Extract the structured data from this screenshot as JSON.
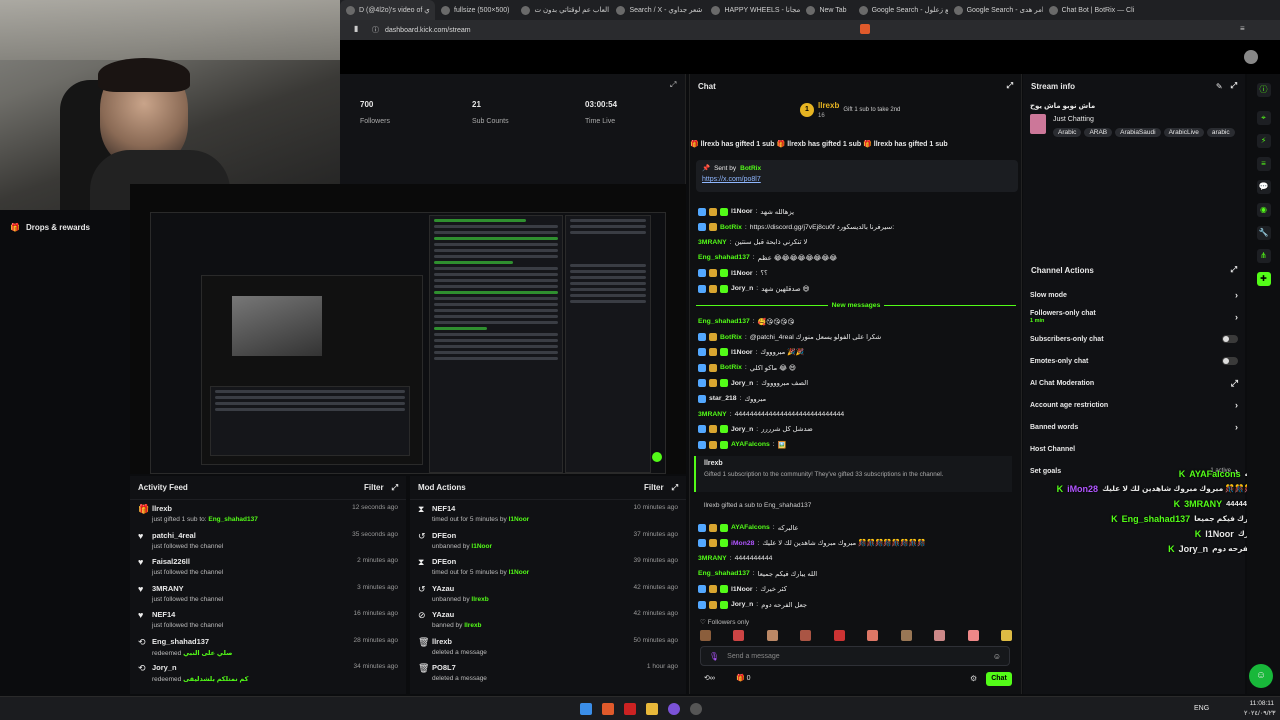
{
  "browser": {
    "tabs": [
      "D (@4l2o)'s video of ي",
      "fullsize (500×500)",
      "العاب عم لوقتاتي بدون ت",
      "Search / X - شعر جداوي",
      "HAPPY WHEELS - مجانا",
      "New Tab",
      "Google Search - بلع زعلول",
      "Google Search - امر هدى",
      "Chat Bot | BotRix — Cli"
    ],
    "url": "dashboard.kick.com/stream"
  },
  "overlay": {
    "drops": "Drops & rewards"
  },
  "stats": [
    {
      "value": "700",
      "label": "Followers"
    },
    {
      "value": "21",
      "label": "Sub Counts"
    },
    {
      "value": "03:00:54",
      "label": "Time Live"
    }
  ],
  "activity": {
    "title": "Activity Feed",
    "filter": "Filter",
    "items": [
      {
        "icon": "gift",
        "name": "llrexb",
        "desc": "just gifted 1 sub to:",
        "target": "Eng_shahad137",
        "time": "12 seconds ago"
      },
      {
        "icon": "heart",
        "name": "patchi_4real",
        "desc": "just followed the channel",
        "target": "",
        "time": "35 seconds ago"
      },
      {
        "icon": "heart",
        "name": "Faisal226ll",
        "desc": "just followed the channel",
        "target": "",
        "time": "2 minutes ago"
      },
      {
        "icon": "heart",
        "name": "3MRANY",
        "desc": "just followed the channel",
        "target": "",
        "time": "3 minutes ago"
      },
      {
        "icon": "heart",
        "name": "NEF14",
        "desc": "just followed the channel",
        "target": "",
        "time": "16 minutes ago"
      },
      {
        "icon": "redeem",
        "name": "Eng_shahad137",
        "desc": "redeemed",
        "target": "صلي على النبي",
        "time": "28 minutes ago"
      },
      {
        "icon": "redeem",
        "name": "Jory_n",
        "desc": "redeemed",
        "target": "كم نمتلكم بلشدليقى",
        "time": "34 minutes ago"
      }
    ]
  },
  "mod": {
    "title": "Mod Actions",
    "filter": "Filter",
    "items": [
      {
        "icon": "timeout",
        "name": "NEF14",
        "desc": "timed out for 5 minutes by",
        "by": "l1Noor",
        "time": "10 minutes ago"
      },
      {
        "icon": "unban",
        "name": "DFEon",
        "desc": "unbanned by",
        "by": "l1Noor",
        "time": "37 minutes ago"
      },
      {
        "icon": "timeout",
        "name": "DFEon",
        "desc": "timed out for 5 minutes by",
        "by": "l1Noor",
        "time": "39 minutes ago"
      },
      {
        "icon": "unban",
        "name": "YAzau",
        "desc": "unbanned by",
        "by": "llrexb",
        "time": "42 minutes ago"
      },
      {
        "icon": "ban",
        "name": "YAzau",
        "desc": "banned by",
        "by": "llrexb",
        "time": "42 minutes ago"
      },
      {
        "icon": "trash",
        "name": "llrexb",
        "desc": "deleted a message",
        "by": "",
        "time": "50 minutes ago"
      },
      {
        "icon": "trash",
        "name": "PO8L7",
        "desc": "deleted a message",
        "by": "",
        "time": "1 hour ago"
      }
    ]
  },
  "chat": {
    "title": "Chat",
    "pinned_user": "llrexb",
    "pinned_count": "16",
    "pinned_text": "Gift 1 sub to take 2nd",
    "gift_ticker": "llrexb has gifted 1 sub",
    "sent_by_label": "Sent by",
    "sent_by_user": "BotRix",
    "sent_link": "https://x.com/po8l7",
    "new_messages": "New messages",
    "messages": [
      {
        "user": "l1Noor",
        "text": "يزهالله شهد",
        "color": "#e8e8e8",
        "badges": 3
      },
      {
        "user": "BotRix",
        "text": "https://discord.gg/j7vEj8cu0f  سيرفرنا بالديسكورد:",
        "color": "#53fc18",
        "badges": 2
      },
      {
        "user": "3MRANY",
        "text": "لا تنكرني ذابحة قبل سنتين",
        "color": "#53fc18",
        "badges": 0
      },
      {
        "user": "Eng_shahad137",
        "text": "عظم 😂😂😂😂😂😂😂😂",
        "color": "#53fc18",
        "badges": 0
      },
      {
        "user": "l1Noor",
        "text": "؟؟",
        "color": "#e8e8e8",
        "badges": 3
      },
      {
        "user": "Jory_n",
        "text": "صدقلهين شهد 😄",
        "color": "#e8e8e8",
        "badges": 3
      },
      {
        "user": "Eng_shahad137",
        "text": "🥰😘😘😘😘",
        "color": "#53fc18",
        "badges": 0
      },
      {
        "user": "BotRix",
        "text": "@patchi_4real شكرا على الفولو يسعل منورك",
        "color": "#53fc18",
        "badges": 2
      },
      {
        "user": "l1Noor",
        "text": "مبروووك 🎉🎉",
        "color": "#e8e8e8",
        "badges": 3
      },
      {
        "user": "BotRix",
        "text": "ماكو اكلي 😂 😄",
        "color": "#53fc18",
        "badges": 2
      },
      {
        "user": "Jory_n",
        "text": "الصف مبرووووك",
        "color": "#e8e8e8",
        "badges": 3
      },
      {
        "user": "star_218",
        "text": "مبرووك",
        "color": "#e8e8e8",
        "badges": 1
      },
      {
        "user": "3MRANY",
        "text": "44444444444444444444444444444",
        "color": "#53fc18",
        "badges": 0
      },
      {
        "user": "Jory_n",
        "text": "ضدشل كل شرررر",
        "color": "#e8e8e8",
        "badges": 3
      },
      {
        "user": "AYAFalcons",
        "text": "🖼️",
        "color": "#53fc18",
        "badges": 3
      }
    ],
    "sub_event_user": "llrexb",
    "sub_event_text": "Gifted 1 subscription to the community! They've gifted 33 subscriptions in the channel.",
    "gift_line": "llrexb gifted a sub to Eng_shahad137",
    "messages2": [
      {
        "user": "AYAFalcons",
        "text": "عالبركه",
        "color": "#53fc18",
        "badges": 3
      },
      {
        "user": "iMon28",
        "text": "مبروك مبروك شاهدين لك لا عليك 🎊🎊🎊🎊🎊🎊🎊🎊",
        "color": "#b055ff",
        "badges": 3
      },
      {
        "user": "3MRANY",
        "text": "4444444444",
        "color": "#53fc18",
        "badges": 0
      },
      {
        "user": "Eng_shahad137",
        "text": "الله يبارك فيكم جميعا",
        "color": "#53fc18",
        "badges": 0
      },
      {
        "user": "l1Noor",
        "text": "كثر خيرك",
        "color": "#e8e8e8",
        "badges": 3
      },
      {
        "user": "Jory_n",
        "text": "جعل الفرحه دوم",
        "color": "#e8e8e8",
        "badges": 3
      }
    ],
    "followers_only": "Followers only",
    "placeholder": "Send a message",
    "counter": "0",
    "send": "Chat"
  },
  "stream_info": {
    "title": "Stream info",
    "stream_title": "ماش نوبو ماش يوح",
    "category": "Just Chatting",
    "tags": [
      "Arabic",
      "ARAB",
      "ArabiaSaudi",
      "ArabicLive",
      "arabic"
    ]
  },
  "channel_actions": {
    "title": "Channel Actions",
    "items": [
      {
        "label": "Slow mode",
        "sub": "",
        "kind": "arrow"
      },
      {
        "label": "Followers-only chat",
        "sub": "1 min",
        "kind": "arrow"
      },
      {
        "label": "Subscribers-only chat",
        "sub": "",
        "kind": "toggle"
      },
      {
        "label": "Emotes-only chat",
        "sub": "",
        "kind": "toggle"
      },
      {
        "label": "AI Chat Moderation",
        "sub": "",
        "kind": "ext"
      },
      {
        "label": "Account age restriction",
        "sub": "",
        "kind": "arrow"
      },
      {
        "label": "Banned words",
        "sub": "",
        "kind": "arrow"
      },
      {
        "label": "Host Channel",
        "sub": "",
        "kind": "none"
      },
      {
        "label": "Set goals",
        "sub": "1 active",
        "kind": "arrow"
      }
    ]
  },
  "overlay_chat": [
    {
      "user": "AYAFalcons",
      "text": "عالبركه",
      "color": "#53fc18"
    },
    {
      "user": "iMon28",
      "text": "مبروك مبروك شاهدين لك لا عليك 🎊🎊🎊🎊🎊",
      "color": "#b055ff"
    },
    {
      "user": "3MRANY",
      "text": "44444444444",
      "color": "#53fc18"
    },
    {
      "user": "Eng_shahad137",
      "text": "الله يبارك فيكم جميعا",
      "color": "#53fc18"
    },
    {
      "user": "l1Noor",
      "text": "كثر خيرك",
      "color": "#e8e8e8"
    },
    {
      "user": "Jory_n",
      "text": "جعل الفرحه دوم",
      "color": "#e8e8e8"
    }
  ],
  "taskbar": {
    "lang": "ENG",
    "time": "11:08:11",
    "date": "٢٠٢٤/٠٩/٢٣"
  }
}
